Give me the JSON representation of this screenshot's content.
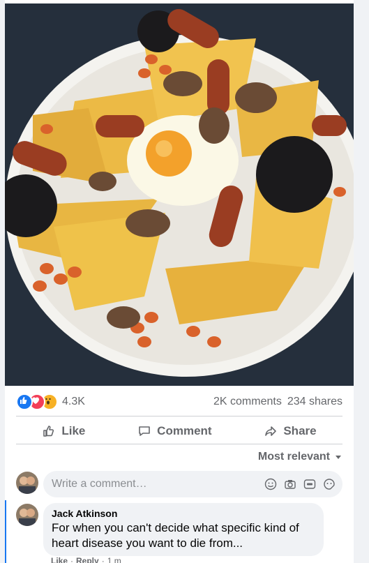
{
  "post": {
    "photo_alt": "Breakfast plate with toast, beans, egg, sausages and mushrooms"
  },
  "reactions": {
    "icons": [
      "like-icon",
      "love-icon",
      "wow-icon"
    ],
    "count": "4.3K",
    "comments": "2K comments",
    "shares": "234 shares"
  },
  "actions": {
    "like": "Like",
    "comment": "Comment",
    "share": "Share"
  },
  "sort": {
    "label": "Most relevant"
  },
  "composer": {
    "placeholder": "Write a comment…",
    "icons": [
      "emoji-icon",
      "camera-icon",
      "gif-icon",
      "sticker-icon"
    ]
  },
  "comments": [
    {
      "author": "Jack Atkinson",
      "text": "For when you can't decide what specific kind of heart disease you want to die from...",
      "like_label": "Like",
      "reply_label": "Reply",
      "time": "1 m"
    }
  ],
  "colors": {
    "accent": "#1877f2",
    "text_secondary": "#65676b",
    "bubble_bg": "#f0f2f5"
  }
}
